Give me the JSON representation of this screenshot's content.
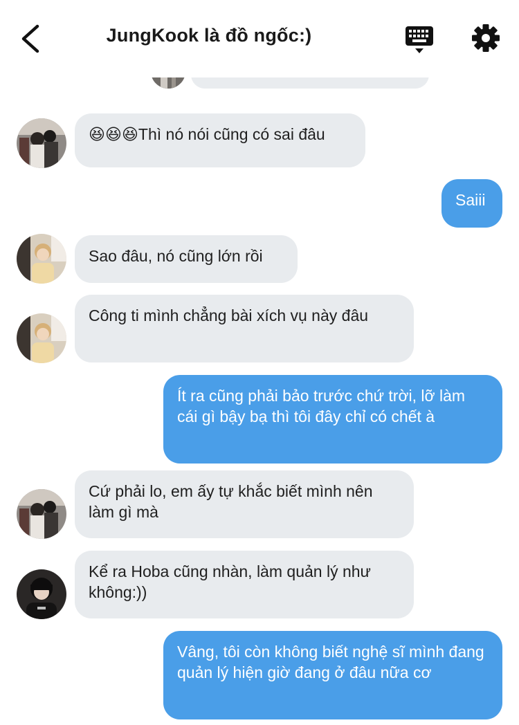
{
  "header": {
    "title": "JungKook là đồ ngốc:)",
    "back_icon": "chevron-left-icon",
    "keyboard_icon": "keyboard-icon",
    "settings_icon": "gear-icon"
  },
  "colors": {
    "incoming_bubble": "#e8ebee",
    "outgoing_bubble": "#4a9ee8",
    "outgoing_text": "#ffffff"
  },
  "messages": [
    {
      "direction": "in",
      "text": "😆😆😆Thì nó nói cũng có sai đâu",
      "avatar": "avatar-couple"
    },
    {
      "direction": "out",
      "text": "Saiii"
    },
    {
      "direction": "in",
      "text": "Sao đâu, nó cũng lớn rồi",
      "avatar": "avatar-blond-boy"
    },
    {
      "direction": "in",
      "text": "Công ti mình chẳng bài xích vụ này đâu",
      "avatar": "avatar-blond-boy"
    },
    {
      "direction": "out",
      "text": "Ít ra cũng phải bảo trước chứ trời, lỡ làm cái gì bậy bạ thì tôi đây chỉ có chết à"
    },
    {
      "direction": "in",
      "text": "Cứ phải lo, em ấy tự khắc biết mình nên làm gì mà",
      "avatar": "avatar-couple"
    },
    {
      "direction": "in",
      "text": "Kể ra Hoba cũng nhàn, làm quản lý như không:))",
      "avatar": "avatar-dark-hair"
    },
    {
      "direction": "out",
      "text": "Vâng, tôi còn không biết nghệ sĩ mình đang quản lý hiện giờ đang ở đâu nữa cơ"
    }
  ]
}
